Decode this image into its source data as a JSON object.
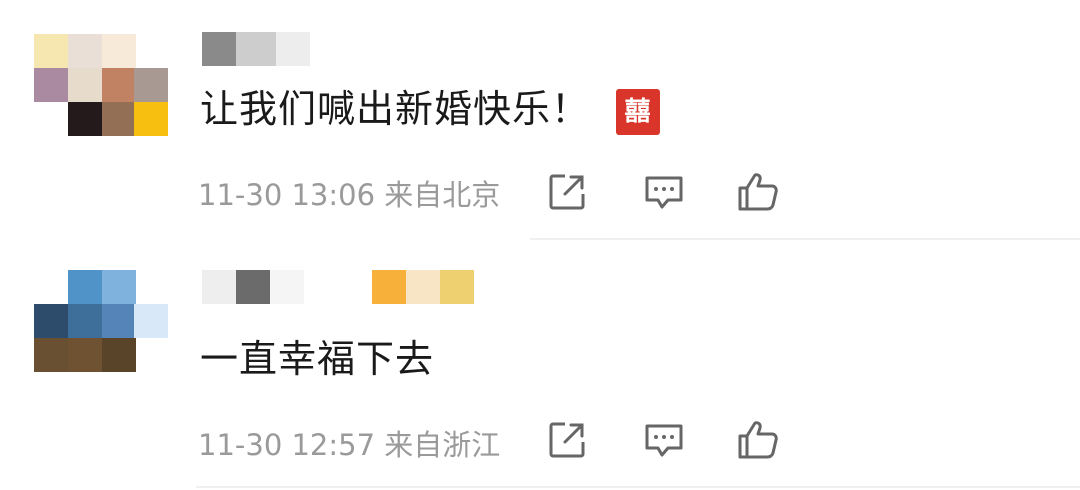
{
  "comments": [
    {
      "text": "让我们喊出新婚快乐！",
      "emoji": "囍",
      "time": "11-30 13:06",
      "location": "来自北京"
    },
    {
      "text": "一直幸福下去",
      "time": "11-30 12:57",
      "location": "来自浙江"
    }
  ],
  "colors": {
    "text": "#1a1a1a",
    "meta": "#9a9a9a",
    "icon": "#666666",
    "emoji_red": "#d9352b"
  },
  "icons": [
    "share-icon",
    "reply-icon",
    "like-icon"
  ]
}
